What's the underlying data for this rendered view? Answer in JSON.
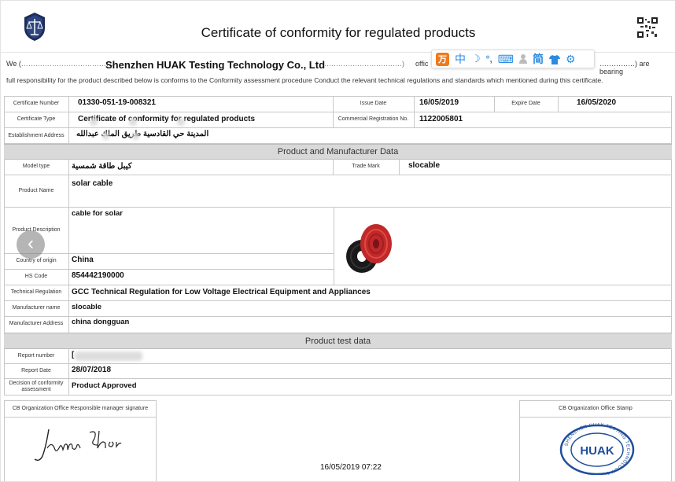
{
  "header": {
    "title": "Certificate of conformity for regulated products",
    "seal_icon": "scales-emblem-icon",
    "qr_icon": "qr-code-icon"
  },
  "intro": {
    "we_prefix": "We (",
    "dots_left": "…………………………………",
    "company": "Shenzhen HUAK Testing Technology Co., Ltd",
    "dots_mid": "……………………………)",
    "offic_partial": "offic",
    "dots_right": "……………) are bearing",
    "line2": "full responsibility for the product described below is conforms to the Conformity assessment procedure Conduct the relevant technical regulations and standards which mentioned during this certificate."
  },
  "ime_toolbar": {
    "logo": "万",
    "items": [
      "中",
      "☽",
      "°,",
      "⌨",
      "👤",
      "简",
      "👕",
      "⚙"
    ]
  },
  "top_table": {
    "certificate_number_label": "Certificate  Number",
    "certificate_number": "01330-051-19-008321",
    "issue_date_label": "Issue Date",
    "issue_date": "16/05/2019",
    "expire_date_label": "Expire Date",
    "expire_date": "16/05/2020",
    "certificate_type_label": "Certificate Type",
    "certificate_type": "Certificate of conformity for regulated products",
    "commercial_reg_label": "Commercial Registration No.",
    "commercial_reg": "1122005801",
    "establishment_label": "Establishment Address",
    "establishment": "المدينة حي القادسية طريق الملك عبدالله"
  },
  "section_product": "Product and Manufacturer Data",
  "product": {
    "model_label": "Model type",
    "model": "كيبل طاقة شمسية",
    "trademark_label": "Trade Mark",
    "trademark": "slocable",
    "name_label": "Product Name",
    "name": "solar cable",
    "desc_label": "Product Description",
    "desc": "cable for solar",
    "origin_label": "Country of origin",
    "origin": "China",
    "hs_label": "HS Code",
    "hs": "854442190000",
    "tech_label": "Technical Regulation",
    "tech": "GCC Technical Regulation for Low Voltage Electrical Equipment and Appliances",
    "manu_name_label": "Manufacturer name",
    "manu_name": "slocable",
    "manu_addr_label": "Manufacturer Address",
    "manu_addr": "china dongguan",
    "image": "solar-cable-coils-photo"
  },
  "section_test": "Product test data",
  "test": {
    "report_number_label": "Report number",
    "report_number": "[",
    "report_date_label": "Report Date",
    "report_date": "28/07/2018",
    "decision_label": "Decision of conformity assessment",
    "decision": "Product Approved"
  },
  "footer": {
    "signature_label": "CB Organization Office Responsible manager signature",
    "signature": "James zhou",
    "timestamp": "16/05/2019 07:22",
    "stamp_label": "CB Organization Office Stamp",
    "stamp_text": "HUAK",
    "stamp_ring": "SHENZHEN HUAK TESTING TECHNOLOGY CO.,LTD"
  },
  "nav": {
    "prev": "‹"
  },
  "colors": {
    "band": "#d9d9d9",
    "stamp_blue": "#1f4e9c",
    "ime_orange": "#f07a1a",
    "ime_blue": "#2b8be0"
  }
}
